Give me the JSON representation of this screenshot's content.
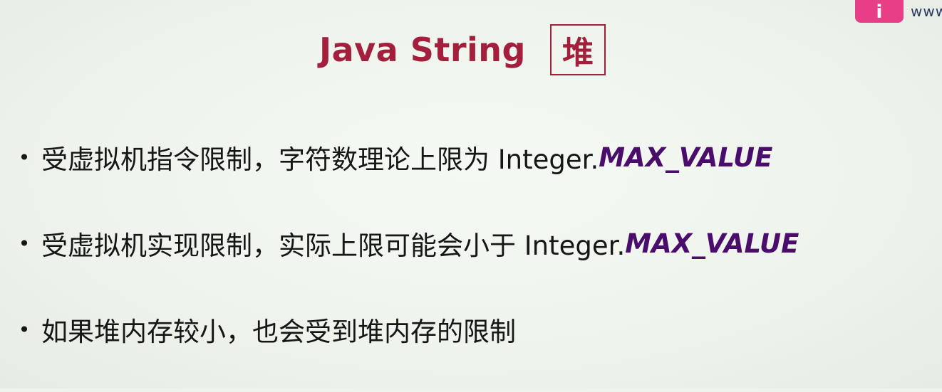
{
  "slide": {
    "title": "Java String",
    "title_box": "堆"
  },
  "bullets": [
    {
      "text": "受虚拟机指令限制，字符数理论上限为 Integer.",
      "emphasis": "MAX_VALUE"
    },
    {
      "text": "受虚拟机实现限制，实际上限可能会小于 Integer.",
      "emphasis": "MAX_VALUE"
    },
    {
      "text": "如果堆内存较小，也会受到堆内存的限制",
      "emphasis": ""
    }
  ],
  "bullet_glyph": "•",
  "watermark": {
    "logo_glyph": "i",
    "url": "www"
  },
  "colors": {
    "title": "#a3203d",
    "emphasis": "#4a0d6b",
    "body_text": "#161616",
    "background": "#eef3ec",
    "logo": "#e83e85"
  }
}
